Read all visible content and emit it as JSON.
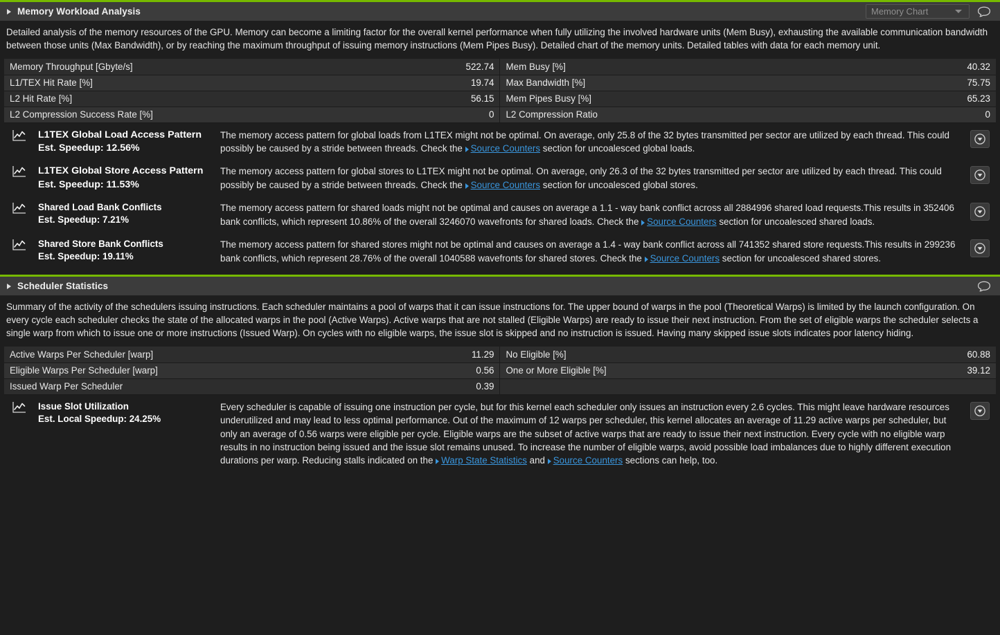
{
  "sections": [
    {
      "id": "memory-workload-analysis",
      "title": "Memory Workload Analysis",
      "expanded_icon": "triangle-right-icon",
      "combo": {
        "value": "Memory Chart",
        "arrow_icon": "chevron-down-icon"
      },
      "comment_icon": "speech-bubble-icon",
      "description": "Detailed analysis of the memory resources of the GPU. Memory can become a limiting factor for the overall kernel performance when fully utilizing the involved hardware units (Mem Busy), exhausting the available communication bandwidth between those units (Max Bandwidth), or by reaching the maximum throughput of issuing memory instructions (Mem Pipes Busy). Detailed chart of the memory units. Detailed tables with data for each memory unit.",
      "metrics": [
        {
          "name": "Memory Throughput [Gbyte/s]",
          "value": "522.74",
          "name2": "Mem Busy [%]",
          "value2": "40.32"
        },
        {
          "name": "L1/TEX Hit Rate [%]",
          "value": "19.74",
          "name2": "Max Bandwidth [%]",
          "value2": "75.75"
        },
        {
          "name": "L2 Hit Rate [%]",
          "value": "56.15",
          "name2": "Mem Pipes Busy [%]",
          "value2": "65.23"
        },
        {
          "name": "L2 Compression Success Rate [%]",
          "value": "0",
          "name2": "L2 Compression Ratio",
          "value2": "0"
        }
      ],
      "recommendations": [
        {
          "icon": "line-chart-icon",
          "title": "L1TEX Global Load Access Pattern",
          "speedup": "Est. Speedup: 12.56%",
          "title_size": "large",
          "body_parts": [
            {
              "type": "text",
              "text": "The memory access pattern for global loads from L1TEX might not be optimal. On average, only 25.8 of the 32 bytes transmitted per sector are utilized by each thread. This could possibly be caused by a stride between threads. Check the "
            },
            {
              "type": "link",
              "text": "Source Counters"
            },
            {
              "type": "text",
              "text": " section for uncoalesced global loads."
            }
          ],
          "button_icon": "circle-chevron-down-icon"
        },
        {
          "icon": "line-chart-icon",
          "title": "L1TEX Global Store Access Pattern",
          "speedup": "Est. Speedup: 11.53%",
          "title_size": "large",
          "body_parts": [
            {
              "type": "text",
              "text": "The memory access pattern for global stores to L1TEX might not be optimal. On average, only 26.3 of the 32 bytes transmitted per sector are utilized by each thread. This could possibly be caused by a stride between threads. Check the "
            },
            {
              "type": "link",
              "text": "Source Counters"
            },
            {
              "type": "text",
              "text": " section for uncoalesced global stores."
            }
          ],
          "button_icon": "circle-chevron-down-icon"
        },
        {
          "icon": "line-chart-icon",
          "title": "Shared Load Bank Conflicts",
          "speedup": "Est. Speedup: 7.21%",
          "title_size": "small",
          "body_parts": [
            {
              "type": "text",
              "text": "The memory access pattern for shared loads might not be optimal and causes on average a 1.1 - way bank conflict across all 2884996 shared load requests.This results in 352406 bank conflicts, which represent 10.86% of the overall 3246070 wavefronts for shared loads. Check the "
            },
            {
              "type": "link",
              "text": "Source Counters"
            },
            {
              "type": "text",
              "text": " section for uncoalesced shared loads."
            }
          ],
          "button_icon": "circle-chevron-down-icon"
        },
        {
          "icon": "line-chart-icon",
          "title": "Shared Store Bank Conflicts",
          "speedup": "Est. Speedup: 19.11%",
          "title_size": "small",
          "body_parts": [
            {
              "type": "text",
              "text": "The memory access pattern for shared stores might not be optimal and causes on average a 1.4 - way bank conflict across all 741352 shared store requests.This results in 299236 bank conflicts, which represent 28.76% of the overall 1040588 wavefronts for shared stores. Check the "
            },
            {
              "type": "link",
              "text": "Source Counters"
            },
            {
              "type": "text",
              "text": " section for uncoalesced shared stores."
            }
          ],
          "button_icon": "circle-chevron-down-icon"
        }
      ]
    },
    {
      "id": "scheduler-statistics",
      "title": "Scheduler Statistics",
      "expanded_icon": "triangle-right-icon",
      "combo": null,
      "comment_icon": "speech-bubble-icon",
      "description": "Summary of the activity of the schedulers issuing instructions. Each scheduler maintains a pool of warps that it can issue instructions for. The upper bound of warps in the pool (Theoretical Warps) is limited by the launch configuration. On every cycle each scheduler checks the state of the allocated warps in the pool (Active Warps). Active warps that are not stalled (Eligible Warps) are ready to issue their next instruction. From the set of eligible warps the scheduler selects a single warp from which to issue one or more instructions (Issued Warp). On cycles with no eligible warps, the issue slot is skipped and no instruction is issued. Having many skipped issue slots indicates poor latency hiding.",
      "metrics": [
        {
          "name": "Active Warps Per Scheduler [warp]",
          "value": "11.29",
          "name2": "No Eligible [%]",
          "value2": "60.88"
        },
        {
          "name": "Eligible Warps Per Scheduler [warp]",
          "value": "0.56",
          "name2": "One or More Eligible [%]",
          "value2": "39.12"
        },
        {
          "name": "Issued Warp Per Scheduler",
          "value": "0.39",
          "name2": "",
          "value2": ""
        }
      ],
      "recommendations": [
        {
          "icon": "line-chart-icon",
          "title": "Issue Slot Utilization",
          "speedup": "Est. Local Speedup: 24.25%",
          "title_size": "small",
          "body_parts": [
            {
              "type": "text",
              "text": "Every scheduler is capable of issuing one instruction per cycle, but for this kernel each scheduler only issues an instruction every 2.6 cycles. This might leave hardware resources underutilized and may lead to less optimal performance. Out of the maximum of 12 warps per scheduler, this kernel allocates an average of 11.29 active warps per scheduler, but only an average of 0.56 warps were eligible per cycle. Eligible warps are the subset of active warps that are ready to issue their next instruction. Every cycle with no eligible warp results in no instruction being issued and the issue slot remains unused. To increase the number of eligible warps, avoid possible load imbalances due to highly different execution durations per warp. Reducing stalls indicated on the "
            },
            {
              "type": "link",
              "text": "Warp State Statistics"
            },
            {
              "type": "text",
              "text": " and "
            },
            {
              "type": "link",
              "text": "Source Counters"
            },
            {
              "type": "text",
              "text": " sections can help, too."
            }
          ],
          "button_icon": "circle-chevron-down-icon"
        }
      ]
    }
  ],
  "colors": {
    "accent_green": "#76b900",
    "link_blue": "#3a96dd",
    "header_bg": "#3c3c3c",
    "page_bg": "#1e1e1e",
    "row_odd": "#2d2d2d",
    "row_even": "#333333"
  }
}
